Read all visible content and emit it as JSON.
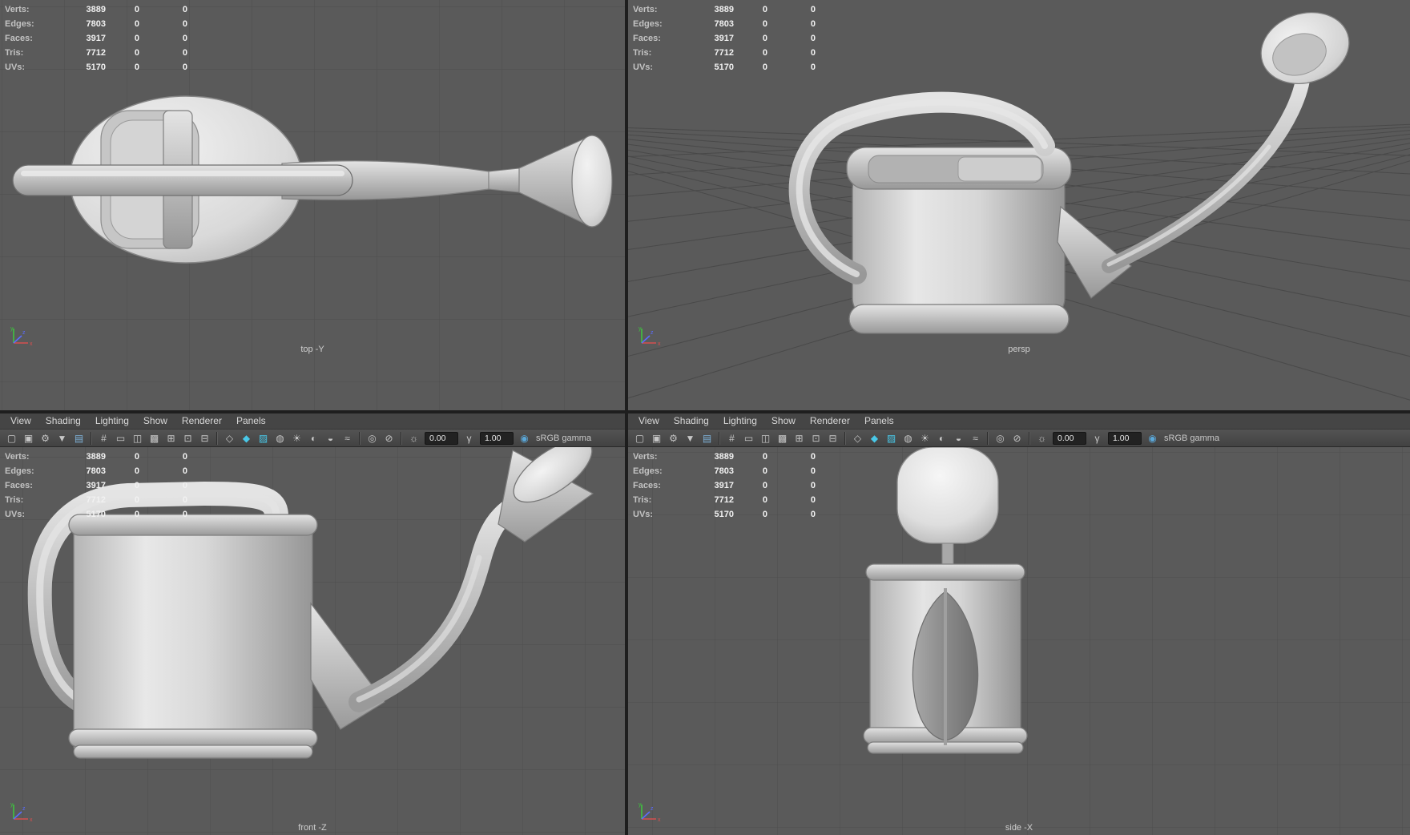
{
  "viewports": {
    "top": {
      "label": "top -Y"
    },
    "persp": {
      "label": "persp"
    },
    "front": {
      "label": "front -Z"
    },
    "side": {
      "label": "side -X"
    }
  },
  "hud": {
    "rows": [
      {
        "label": "Verts:",
        "values": [
          "3889",
          "0",
          "0"
        ]
      },
      {
        "label": "Edges:",
        "values": [
          "7803",
          "0",
          "0"
        ]
      },
      {
        "label": "Faces:",
        "values": [
          "3917",
          "0",
          "0"
        ]
      },
      {
        "label": "Tris:",
        "values": [
          "7712",
          "0",
          "0"
        ]
      },
      {
        "label": "UVs:",
        "values": [
          "5170",
          "0",
          "0"
        ]
      }
    ]
  },
  "panel_menu": {
    "items": [
      "View",
      "Shading",
      "Lighting",
      "Show",
      "Renderer",
      "Panels"
    ]
  },
  "toolbar": {
    "items": [
      {
        "type": "icon",
        "name": "camera-icon",
        "glyph": "▢"
      },
      {
        "type": "icon",
        "name": "lock-camera-icon",
        "glyph": "▣"
      },
      {
        "type": "icon",
        "name": "camera-attributes-icon",
        "glyph": "⚙"
      },
      {
        "type": "icon",
        "name": "bookmarks-icon",
        "glyph": "▼"
      },
      {
        "type": "icon",
        "name": "image-plane-icon",
        "glyph": "▤",
        "color": "#7fb2d9"
      },
      {
        "type": "sep"
      },
      {
        "type": "icon",
        "name": "grid-icon",
        "glyph": "#"
      },
      {
        "type": "icon",
        "name": "film-gate-icon",
        "glyph": "▭"
      },
      {
        "type": "icon",
        "name": "resolution-gate-icon",
        "glyph": "◫"
      },
      {
        "type": "icon",
        "name": "gate-mask-icon",
        "glyph": "▩"
      },
      {
        "type": "icon",
        "name": "field-chart-icon",
        "glyph": "⊞"
      },
      {
        "type": "icon",
        "name": "safe-action-icon",
        "glyph": "⊡"
      },
      {
        "type": "icon",
        "name": "safe-title-icon",
        "glyph": "⊟"
      },
      {
        "type": "sep"
      },
      {
        "type": "icon",
        "name": "wireframe-icon",
        "glyph": "◇"
      },
      {
        "type": "icon",
        "name": "smooth-shade-icon",
        "glyph": "◆",
        "color": "#49c8e8"
      },
      {
        "type": "icon",
        "name": "textured-icon",
        "glyph": "▨",
        "color": "#49c8e8"
      },
      {
        "type": "icon",
        "name": "use-default-material-icon",
        "glyph": "◍"
      },
      {
        "type": "icon",
        "name": "lights-icon",
        "glyph": "☀"
      },
      {
        "type": "icon",
        "name": "shadows-icon",
        "glyph": "◐"
      },
      {
        "type": "icon",
        "name": "occlusion-icon",
        "glyph": "◒"
      },
      {
        "type": "icon",
        "name": "motion-blur-icon",
        "glyph": "≈"
      },
      {
        "type": "sep"
      },
      {
        "type": "icon",
        "name": "isolate-select-icon",
        "glyph": "◎"
      },
      {
        "type": "icon",
        "name": "xray-icon",
        "glyph": "⊘"
      },
      {
        "type": "sep"
      },
      {
        "type": "icon",
        "name": "exposure-icon",
        "glyph": "☼"
      },
      {
        "type": "field",
        "name": "exposure-field",
        "value": "0.00"
      },
      {
        "type": "icon",
        "name": "gamma-icon",
        "glyph": "γ"
      },
      {
        "type": "field",
        "name": "gamma-field",
        "value": "1.00"
      },
      {
        "type": "icon",
        "name": "view-transform-icon",
        "glyph": "◉",
        "color": "#5aa7d8"
      },
      {
        "type": "label",
        "name": "color-management-label",
        "value": "sRGB gamma"
      }
    ]
  },
  "axis": {
    "x": "x",
    "y": "y",
    "z": "z"
  },
  "colors": {
    "viewport_bg": "#5a5a5a",
    "grid_line": "#4e4e4e",
    "menubar_bg": "#454545",
    "toolbar_bg": "#4a4a4a",
    "accent_teal": "#49c8e8",
    "axis_x": "#d65050",
    "axis_y": "#3ec43e",
    "axis_z": "#5b6cff"
  }
}
